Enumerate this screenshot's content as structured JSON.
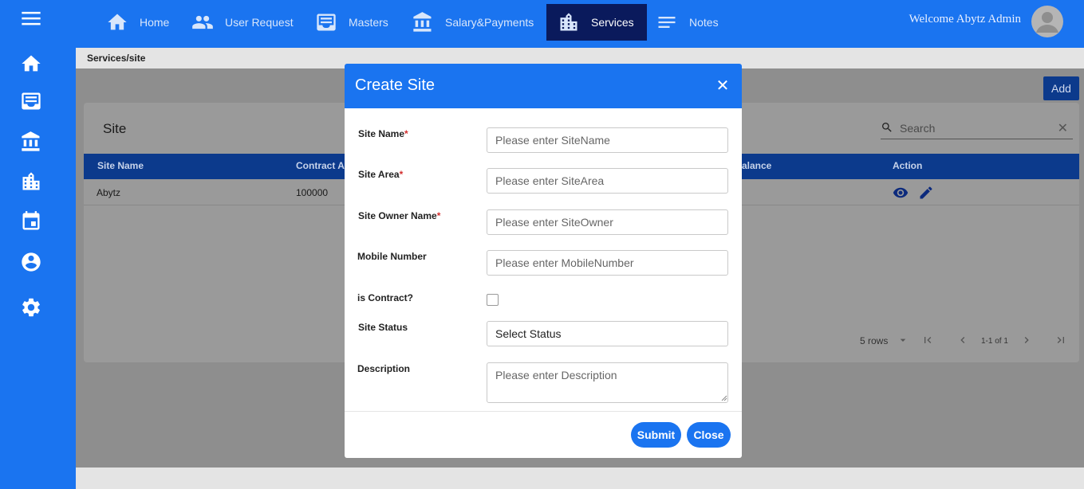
{
  "nav": {
    "items": [
      {
        "label": "Home",
        "icon": "home-icon"
      },
      {
        "label": "User Request",
        "icon": "people-icon"
      },
      {
        "label": "Masters",
        "icon": "inbox-icon"
      },
      {
        "label": "Salary&Payments",
        "icon": "bank-icon"
      },
      {
        "label": "Services",
        "icon": "building-icon",
        "active": true
      },
      {
        "label": "Notes",
        "icon": "notes-icon"
      }
    ],
    "welcome": "Welcome Abytz Admin"
  },
  "sidebar": {
    "icons": [
      "menu-icon",
      "home-icon",
      "inbox-icon",
      "bank-icon",
      "building-icon",
      "calendar-icon",
      "account-icon",
      "settings-icon"
    ]
  },
  "breadcrumb": "Services/site",
  "add_label": "Add",
  "card": {
    "title": "Site",
    "search_placeholder": "Search",
    "clear_symbol": "✕",
    "columns": [
      "Site Name",
      "Contract A",
      "alance",
      "Action"
    ],
    "rows": [
      {
        "site_name": "Abytz",
        "contract": "100000"
      }
    ],
    "pager": {
      "rows_label": "5 rows",
      "range": "1-1 of 1"
    }
  },
  "modal": {
    "title": "Create Site",
    "close_symbol": "✕",
    "fields": {
      "site_name": {
        "label": "Site Name",
        "required": "*",
        "placeholder": "Please enter SiteName"
      },
      "site_area": {
        "label": "Site Area",
        "required": "*",
        "placeholder": "Please enter SiteArea"
      },
      "site_owner": {
        "label": "Site Owner Name",
        "required": "*",
        "placeholder": "Please enter SiteOwner"
      },
      "mobile": {
        "label": "Mobile Number",
        "placeholder": "Please enter MobileNumber"
      },
      "is_contract": {
        "label": "is Contract?"
      },
      "status": {
        "label": "Site Status",
        "value": "Select Status"
      },
      "description": {
        "label": "Description",
        "placeholder": "Please enter Description"
      }
    },
    "submit_label": "Submit",
    "close_label": "Close"
  },
  "colors": {
    "primary": "#1a74f0",
    "dark_blue": "#0c3a8c",
    "nav_active": "#0a1a5c",
    "required": "#d32f2f"
  }
}
